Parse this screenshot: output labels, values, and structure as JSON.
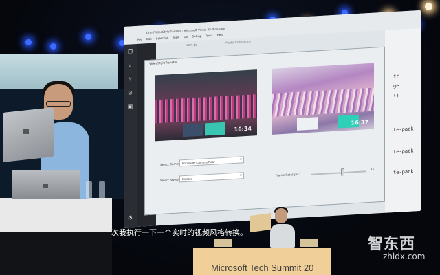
{
  "vscode": {
    "window_title": "OmniVideoStyleTransfer - Microsoft Visual Studio Code",
    "menu": [
      "File",
      "Edit",
      "Selection",
      "View",
      "Go",
      "Debug",
      "Tasks",
      "Help"
    ],
    "tabs": [
      "train.py",
      "ModelTransfer.py"
    ],
    "code_lines": [
      "fr",
      "ge",
      "()",
      "te-pack",
      "te-pack",
      "te-pack"
    ]
  },
  "app": {
    "title": "VideoStyleTransfer",
    "left_clock": "16:34",
    "right_clock": "16:37",
    "camera_label": "Select Camera",
    "camera_value": "Microsoft Camera Rear",
    "styles_label": "Select Styles",
    "styles_value": "Mosaic",
    "frame_rate_label": "Frame Rate(fps):",
    "frame_rate_value": "15"
  },
  "subtitle": "次我执行一下一个实时的视频风格转换。",
  "banner": "Microsoft Tech Summit 20",
  "watermark": {
    "cn": "智东西",
    "en": "zhidx.com"
  }
}
